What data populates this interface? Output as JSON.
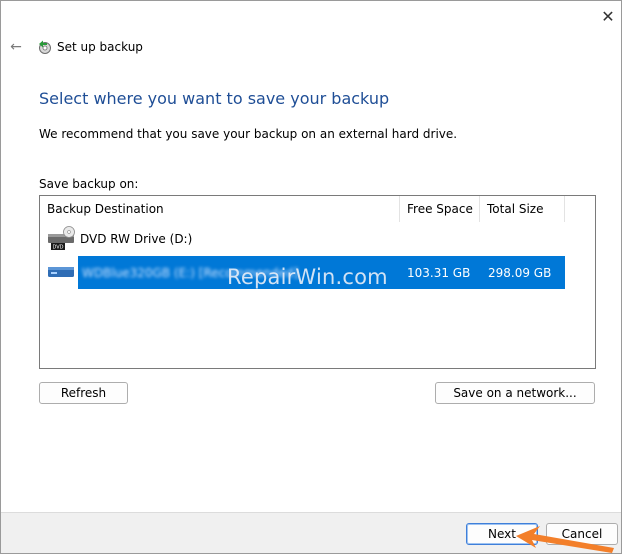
{
  "window": {
    "title": "Set up backup",
    "close_glyph": "✕",
    "back_glyph": "←"
  },
  "heading": "Select where you want to save your backup",
  "recommendation": "We recommend that you save your backup on an external hard drive.",
  "save_backup_on_label": "Save backup on:",
  "table": {
    "columns": [
      "Backup Destination",
      "Free Space",
      "Total Size"
    ],
    "rows": [
      {
        "icon": "dvd-drive-icon",
        "name": "DVD RW Drive (D:)",
        "free_space": "",
        "total_size": ""
      },
      {
        "icon": "hard-drive-icon",
        "name": "WDBlue320GB (E:) [Recommended]",
        "free_space": "103.31 GB",
        "total_size": "298.09 GB",
        "selected": true
      }
    ]
  },
  "watermark": "RepairWin.com",
  "buttons": {
    "refresh": "Refresh",
    "save_on_network": "Save on a network...",
    "next": "Next",
    "cancel": "Cancel"
  },
  "colors": {
    "heading": "#1f4e96",
    "selection": "#0078d7",
    "footer": "#f0f0f0",
    "pointer_arrow": "#f37f2a"
  }
}
